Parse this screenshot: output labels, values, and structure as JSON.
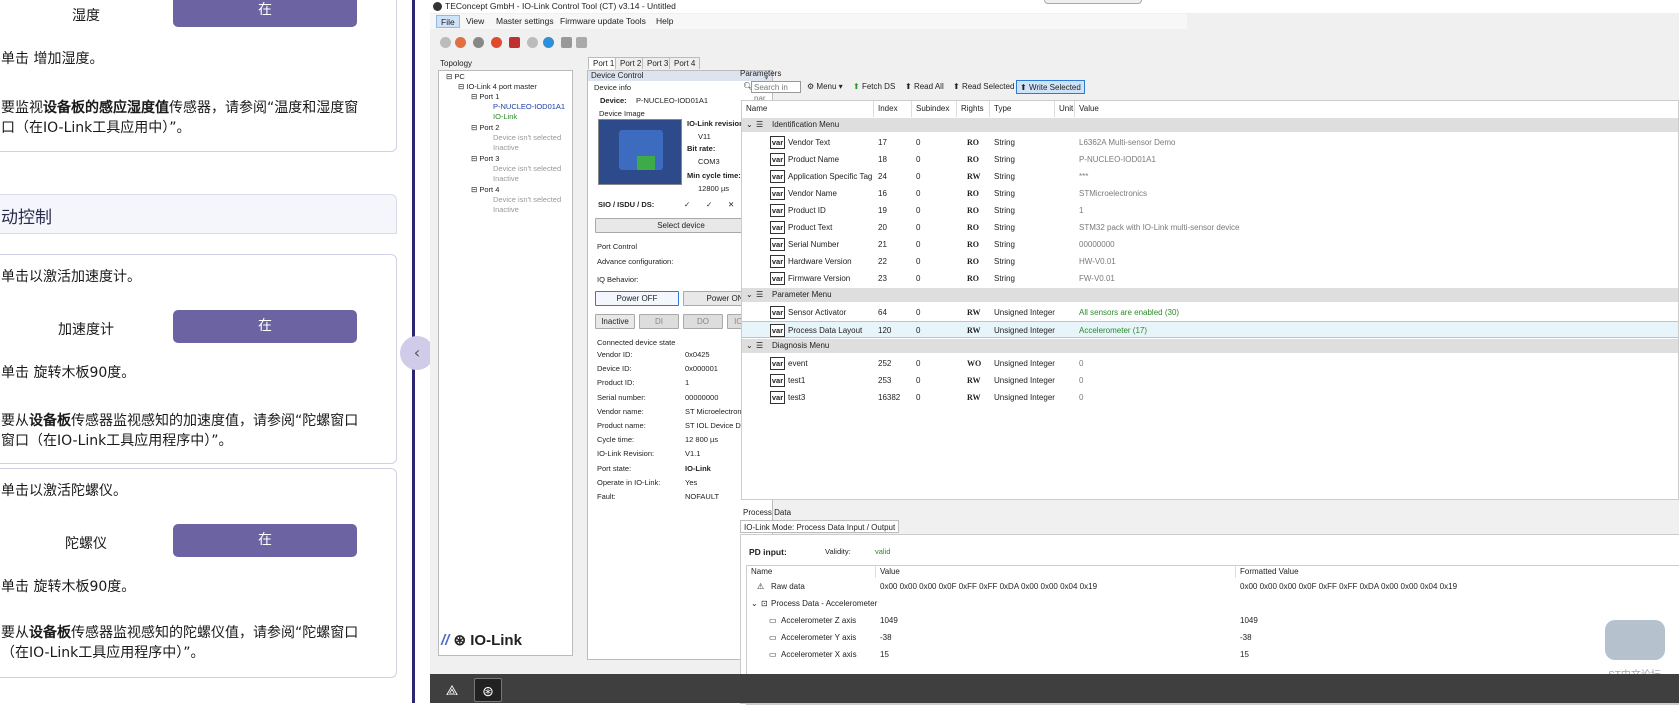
{
  "doc": {
    "top_label": "湿度",
    "top_button": "在",
    "p1": "单击 增加湿度。",
    "p2a": "要监视",
    "p2b": "设备板的感应湿度值",
    "p2c": "传感器，请参阅“温度和湿度窗",
    "p2d": "口（在IO-Link工具应用中）”。",
    "section_title": "动控制",
    "p3": "单击以激活加速度计。",
    "accel_label": "加速度计",
    "accel_button": "在",
    "p4": "单击 旋转木板90度。",
    "p5a": "要从",
    "p5b": "设备板",
    "p5c": "传感器监视感知的加速度值，请参阅“陀螺窗口",
    "p5d": "窗口（在IO-Link工具应用程序中）”。",
    "p6": "单击以激活陀螺仪。",
    "gyro_label": "陀螺仪",
    "gyro_button": "在",
    "p7": "单击 旋转木板90度。",
    "p8a": "要从",
    "p8b": "设备板",
    "p8c": "传感器监视感知的陀螺仪值，请参阅“陀螺窗口",
    "p8d": "（在IO-Link工具应用程序中）”。",
    "collapse_glyph": "‹"
  },
  "app": {
    "title": "TEConcept GmbH - IO-Link Control Tool (CT) v3.14 - Untitled",
    "menus": [
      "File",
      "View",
      "Master settings",
      "Firmware update",
      "Tools",
      "Help"
    ],
    "topology": {
      "label": "Topology",
      "pc": "PC",
      "master": "IO-Link 4 port master",
      "port1": "Port 1",
      "port1_dev": "P-NUCLEO-IOD01A1",
      "port1_mode": "IO-Link",
      "port2": "Port 2",
      "port3": "Port 3",
      "port4": "Port 4",
      "not_selected": "Device isn't selected",
      "inactive": "Inactive",
      "logo": "IO-Link"
    },
    "port_tabs": [
      "Port 1",
      "Port 2",
      "Port 3",
      "Port 4"
    ],
    "device_control": {
      "header": "Device Control",
      "pin": "ᵩ",
      "device_info": "Device info",
      "device_label": "Device:",
      "device_value": "P-NUCLEO-IOD01A1",
      "device_image": "Device Image",
      "iol_rev_label": "IO-Link revision:",
      "iol_rev_value": "V11",
      "bitrate_label": "Bit rate:",
      "bitrate_value": "COM3",
      "cycle_label": "Min cycle time:",
      "cycle_value": "12800 µs",
      "sio_label": "SIO / ISDU / DS:",
      "sio_values": [
        "✓",
        "✓",
        "✕"
      ],
      "select_device": "Select device",
      "port_control": "Port Control",
      "adv_config": "Advance configuration:",
      "iq_behavior": "IQ Behavior:",
      "power_off": "Power OFF",
      "power_on": "Power ON",
      "modes": [
        "Inactive",
        "DI",
        "DO",
        "IO-Link"
      ],
      "connected_state": "Connected device state",
      "state": [
        {
          "k": "Vendor ID:",
          "v": "0x0425"
        },
        {
          "k": "Device ID:",
          "v": "0x000001"
        },
        {
          "k": "Product ID:",
          "v": "1"
        },
        {
          "k": "Serial number:",
          "v": "00000000"
        },
        {
          "k": "Vendor name:",
          "v": "ST Microelectronics"
        },
        {
          "k": "Product name:",
          "v": "ST IOL Device Demo"
        },
        {
          "k": "Cycle time:",
          "v": "12 800 µs"
        },
        {
          "k": "IO-Link Revision:",
          "v": "V1.1"
        },
        {
          "k": "Port state:",
          "v": "IO-Link"
        },
        {
          "k": "Operate in IO-Link:",
          "v": "Yes"
        },
        {
          "k": "Fault:",
          "v": "NOFAULT"
        }
      ]
    },
    "parameters": {
      "label": "Parameters",
      "search_placeholder": "Search in par",
      "toolbar": [
        "Menu ▾",
        "Fetch DS",
        "Read All",
        "Read Selected",
        "Write Selected"
      ],
      "columns": [
        "Name",
        "Index",
        "Subindex",
        "Rights",
        "Type",
        "Unit",
        "Value"
      ],
      "groups": [
        {
          "name": "Identification Menu",
          "rows": [
            {
              "name": "Vendor Text",
              "index": "17",
              "sub": "0",
              "rights": "RO",
              "type": "String",
              "value": "L6362A Multi-sensor Demo"
            },
            {
              "name": "Product Name",
              "index": "18",
              "sub": "0",
              "rights": "RO",
              "type": "String",
              "value": "P-NUCLEO-IOD01A1"
            },
            {
              "name": "Application Specific Tag",
              "index": "24",
              "sub": "0",
              "rights": "RW",
              "type": "String",
              "value": "***"
            },
            {
              "name": "Vendor Name",
              "index": "16",
              "sub": "0",
              "rights": "RO",
              "type": "String",
              "value": "STMicroelectronics"
            },
            {
              "name": "Product ID",
              "index": "19",
              "sub": "0",
              "rights": "RO",
              "type": "String",
              "value": "1"
            },
            {
              "name": "Product Text",
              "index": "20",
              "sub": "0",
              "rights": "RO",
              "type": "String",
              "value": "STM32 pack with IO-Link multi-sensor device"
            },
            {
              "name": "Serial Number",
              "index": "21",
              "sub": "0",
              "rights": "RO",
              "type": "String",
              "value": "00000000"
            },
            {
              "name": "Hardware Version",
              "index": "22",
              "sub": "0",
              "rights": "RO",
              "type": "String",
              "value": "HW-V0.01"
            },
            {
              "name": "Firmware Version",
              "index": "23",
              "sub": "0",
              "rights": "RO",
              "type": "String",
              "value": "FW-V0.01"
            }
          ]
        },
        {
          "name": "Parameter Menu",
          "rows": [
            {
              "name": "Sensor Activator",
              "index": "64",
              "sub": "0",
              "rights": "RW",
              "type": "Unsigned Integer",
              "value": "All sensors are enabled (30)"
            },
            {
              "name": "Process Data Layout",
              "index": "120",
              "sub": "0",
              "rights": "RW",
              "type": "Unsigned Integer",
              "value": "Accelerometer (17)"
            }
          ]
        },
        {
          "name": "Diagnosis Menu",
          "rows": [
            {
              "name": "event",
              "index": "252",
              "sub": "0",
              "rights": "WO",
              "type": "Unsigned Integer",
              "value": "0"
            },
            {
              "name": "test1",
              "index": "253",
              "sub": "0",
              "rights": "RW",
              "type": "Unsigned Integer",
              "value": "0"
            },
            {
              "name": "test3",
              "index": "16382",
              "sub": "0",
              "rights": "RW",
              "type": "Unsigned Integer",
              "value": "0"
            }
          ]
        }
      ]
    },
    "process_data": {
      "label": "Process Data",
      "tab": "IO-Link Mode: Process Data Input / Output",
      "pd_input": "PD input:",
      "validity_label": "Validity:",
      "validity_value": "valid",
      "columns": [
        "Name",
        "Value",
        "Formatted Value"
      ],
      "raw_name": "Raw data",
      "raw_value": "0x00 0x00 0x00 0x0F 0xFF 0xFF 0xDA 0x00 0x00 0x04 0x19",
      "raw_formatted": "0x00 0x00 0x00 0x0F 0xFF 0xFF 0xDA 0x00 0x00 0x04 0x19",
      "group": "Process Data - Accelerometer",
      "rows": [
        {
          "name": "Accelerometer Z axis",
          "value": "1049",
          "formatted": "1049"
        },
        {
          "name": "Accelerometer Y axis",
          "value": "-38",
          "formatted": "-38"
        },
        {
          "name": "Accelerometer X axis",
          "value": "15",
          "formatted": "15"
        }
      ]
    },
    "watermark": "ST中文论坛"
  }
}
